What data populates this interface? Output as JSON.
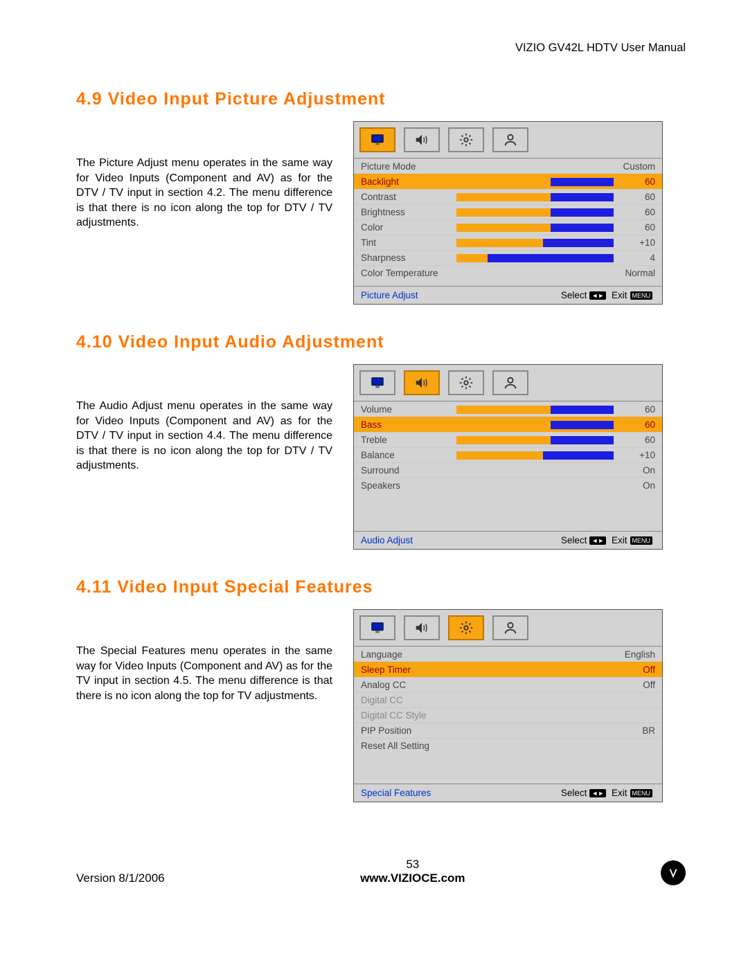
{
  "header": "VIZIO GV42L HDTV User Manual",
  "sections": [
    {
      "heading": "4.9 Video Input Picture Adjustment",
      "paragraph": "The Picture Adjust menu operates in the same way for Video Inputs (Component and AV) as for the DTV / TV input in section 4.2.  The menu difference is that there is no icon along the top for DTV / TV adjustments.",
      "menu": {
        "active_tab": 0,
        "rows": [
          {
            "label": "Picture Mode",
            "value": "Custom",
            "bar": null
          },
          {
            "label": "Backlight",
            "value": "60",
            "bar": 60,
            "highlight": true
          },
          {
            "label": "Contrast",
            "value": "60",
            "bar": 60
          },
          {
            "label": "Brightness",
            "value": "60",
            "bar": 60
          },
          {
            "label": "Color",
            "value": "60",
            "bar": 60
          },
          {
            "label": "Tint",
            "value": "+10",
            "bar": 55
          },
          {
            "label": "Sharpness",
            "value": "4",
            "bar": 20
          },
          {
            "label": "Color Temperature",
            "value": "Normal",
            "bar": null
          }
        ],
        "spacer": 8,
        "footer_title": "Picture Adjust",
        "footer_select": "Select",
        "footer_exit": "Exit"
      }
    },
    {
      "heading": "4.10 Video Input Audio Adjustment",
      "paragraph": "The Audio Adjust menu operates in the same way for Video Inputs (Component and AV) as for the DTV / TV input in section 4.4.  The menu difference is that there is no icon along the top for DTV / TV adjustments.",
      "menu": {
        "active_tab": 1,
        "rows": [
          {
            "label": "Volume",
            "value": "60",
            "bar": 60
          },
          {
            "label": "Bass",
            "value": "60",
            "bar": 60,
            "highlight": true
          },
          {
            "label": "Treble",
            "value": "60",
            "bar": 60
          },
          {
            "label": "Balance",
            "value": "+10",
            "bar": 55
          },
          {
            "label": "Surround",
            "value": "On",
            "bar": null
          },
          {
            "label": "Speakers",
            "value": "On",
            "bar": null
          }
        ],
        "spacer": 55,
        "footer_title": "Audio Adjust",
        "footer_select": "Select",
        "footer_exit": "Exit"
      }
    },
    {
      "heading": "4.11 Video Input Special Features",
      "paragraph": "The Special Features menu operates in the same way for Video Inputs (Component and AV) as for the TV input in section 4.5.  The menu difference is that there is no icon along the top for TV adjustments.",
      "menu": {
        "active_tab": 2,
        "rows": [
          {
            "label": "Language",
            "value": "English",
            "bar": null
          },
          {
            "label": "Sleep Timer",
            "value": "Off",
            "bar": null,
            "highlight": true
          },
          {
            "label": "Analog CC",
            "value": "Off",
            "bar": null
          },
          {
            "label": "Digital CC",
            "value": "",
            "bar": null,
            "disabled": true
          },
          {
            "label": "Digital CC Style",
            "value": "",
            "bar": null,
            "disabled": true
          },
          {
            "label": "PIP Position",
            "value": "BR",
            "bar": null
          },
          {
            "label": "Reset All Setting",
            "value": "",
            "bar": null
          }
        ],
        "spacer": 44,
        "footer_title": "Special Features",
        "footer_select": "Select",
        "footer_exit": "Exit"
      }
    }
  ],
  "footer": {
    "version": "Version 8/1/2006",
    "page": "53",
    "url": "www.VIZIOCE.com"
  },
  "icons": {
    "chip_dir": "◄►",
    "chip_menu": "MENU"
  }
}
